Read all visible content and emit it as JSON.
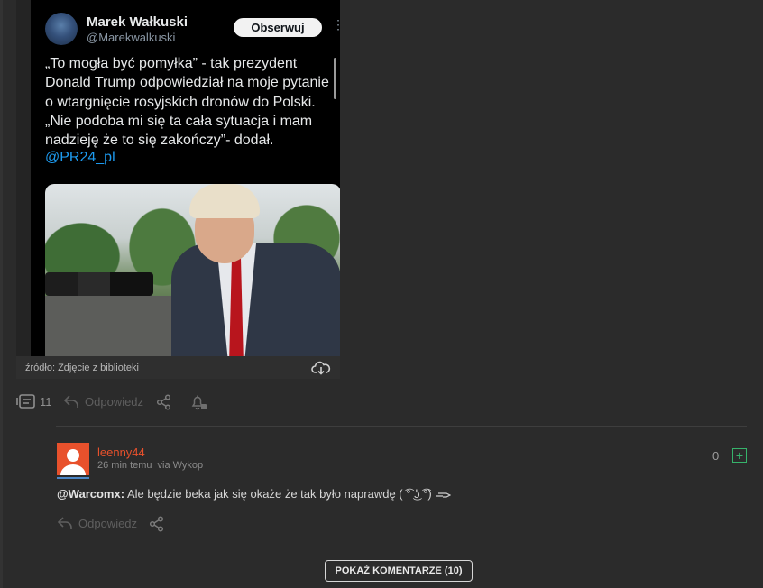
{
  "tweet": {
    "author_name": "Marek Wałkuski",
    "author_handle": "@Marekwalkuski",
    "follow_label": "Obserwuj",
    "menu_glyph": "⋮",
    "text": "„To mogła być pomyłka” - tak prezydent Donald Trump odpowiedział na moje pytanie o wtargnięcie rosyjskich dronów do Polski. „Nie podoba mi się ta cała sytuacja i mam nadzieję że to się zakończy”- dodał.",
    "mention": "@PR24_pl"
  },
  "embed": {
    "source_text": "źródło: Zdjęcie z biblioteki",
    "download_icon": "cloud-download-icon"
  },
  "entry_actions": {
    "comment_count": "11",
    "reply_label": "Odpowiedz",
    "share_icon": "share-icon",
    "notify_icon": "bell-icon"
  },
  "comment": {
    "author": "leenny44",
    "time": "26 min temu",
    "via": "via Wykop",
    "vote_count": "0",
    "plus_label": "+",
    "mention": "@Warcomx:",
    "text": " Ale będzie beka jak się okaże że tak było naprawdę ( ͡° ͜ʖ ͡°) ",
    "reply_label": "Odpowiedz"
  },
  "show_comments_label": "POKAŻ KOMENTARZE (10)",
  "colors": {
    "background": "#2b2b2b",
    "author_orange": "#e8512c",
    "plus_green": "#36b36b",
    "link_blue": "#1d9bf0"
  }
}
